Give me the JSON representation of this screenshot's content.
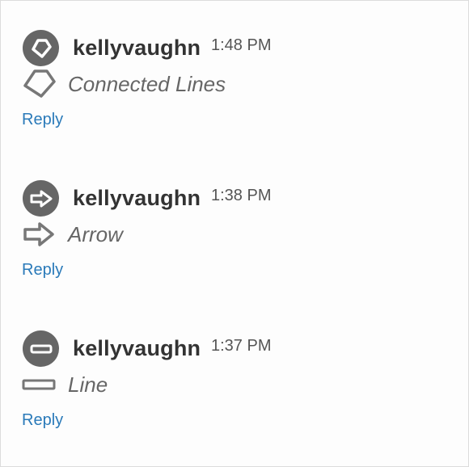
{
  "comments": [
    {
      "username": "kellyvaughn",
      "time": "1:48 PM",
      "text": "Connected Lines",
      "icon": "connected-lines-icon",
      "reply_label": "Reply"
    },
    {
      "username": "kellyvaughn",
      "time": "1:38 PM",
      "text": "Arrow",
      "icon": "arrow-icon",
      "reply_label": "Reply"
    },
    {
      "username": "kellyvaughn",
      "time": "1:37 PM",
      "text": "Line",
      "icon": "line-icon",
      "reply_label": "Reply"
    }
  ],
  "colors": {
    "avatar": "#666666",
    "username": "#333333",
    "link": "#2a7ab9",
    "icon": "#777777"
  }
}
